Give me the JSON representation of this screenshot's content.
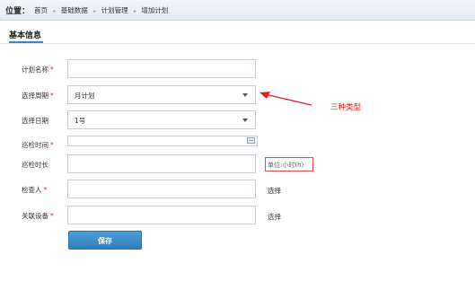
{
  "header": {
    "location_label": "位置：",
    "breadcrumbs": [
      "首页",
      "基础数据",
      "计划管理",
      "增加计划"
    ]
  },
  "section": {
    "title": "基本信息"
  },
  "form": {
    "fields": [
      {
        "label": "计划名称",
        "required": true,
        "value": ""
      },
      {
        "label": "选择周期",
        "required": true,
        "value": "月计划"
      },
      {
        "label": "选择日期",
        "required": false,
        "value": "1号"
      },
      {
        "label": "巡检时间",
        "required": true,
        "value": ""
      },
      {
        "label": "巡检时长",
        "required": false,
        "value": ""
      },
      {
        "label": "检查人",
        "required": true,
        "value": ""
      },
      {
        "label": "关联设备",
        "required": true,
        "value": ""
      }
    ],
    "duration_unit_hint": "单位:小时(h)",
    "select_link": "选择",
    "save_label": "保存"
  },
  "annotation": {
    "text": "三种类型",
    "color": "#e02020"
  },
  "colors": {
    "primary_button": "#3a8ccc",
    "tab_underline": "#3f85c6"
  }
}
